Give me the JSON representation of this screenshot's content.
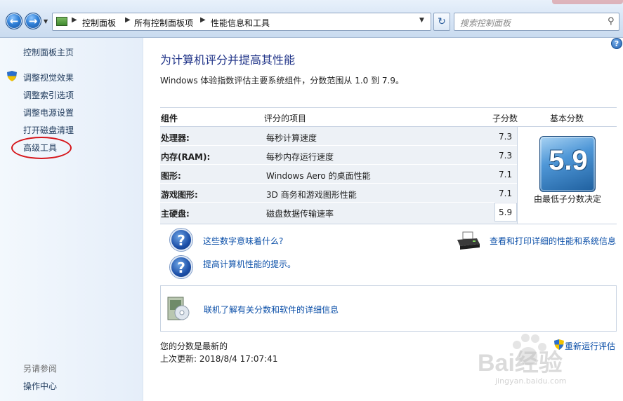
{
  "address_bar": {
    "breadcrumbs": [
      "控制面板",
      "所有控制面板项",
      "性能信息和工具"
    ],
    "search_placeholder": "搜索控制面板"
  },
  "sidebar": {
    "home": "控制面板主页",
    "items": [
      {
        "label": "调整视觉效果",
        "icon": "shield-icon"
      },
      {
        "label": "调整索引选项"
      },
      {
        "label": "调整电源设置"
      },
      {
        "label": "打开磁盘清理"
      },
      {
        "label": "高级工具"
      }
    ],
    "see_also_title": "另请参阅",
    "see_also_items": [
      "操作中心"
    ]
  },
  "main": {
    "title": "为计算机评分并提高其性能",
    "description": "Windows 体验指数评估主要系统组件，分数范围从 1.0 到 7.9。",
    "table": {
      "headers": [
        "组件",
        "评分的项目",
        "子分数",
        "基本分数"
      ],
      "rows": [
        {
          "component": "处理器:",
          "item": "每秒计算速度",
          "subscore": "7.3"
        },
        {
          "component": "内存(RAM):",
          "item": "每秒内存运行速度",
          "subscore": "7.3"
        },
        {
          "component": "图形:",
          "item": "Windows Aero 的桌面性能",
          "subscore": "7.1"
        },
        {
          "component": "游戏图形:",
          "item": "3D 商务和游戏图形性能",
          "subscore": "7.1"
        },
        {
          "component": "主硬盘:",
          "item": "磁盘数据传输速率",
          "subscore": "5.9"
        }
      ],
      "base_score": "5.9",
      "base_caption": "由最低子分数决定"
    },
    "links": {
      "what_numbers_mean": "这些数字意味着什么?",
      "tips": "提高计算机性能的提示。",
      "print_details": "查看和打印详细的性能和系统信息",
      "online_info": "联机了解有关分数和软件的详细信息"
    },
    "status": {
      "line1": "您的分数是最新的",
      "line2": "上次更新: 2018/8/4 17:07:41",
      "rerun": "重新运行评估"
    }
  },
  "watermark": {
    "text": "Bai经验",
    "url": "jingyan.baidu.com"
  },
  "colors": {
    "link": "#0b4fa8",
    "title": "#1e3287",
    "annotation": "#d6161b"
  }
}
